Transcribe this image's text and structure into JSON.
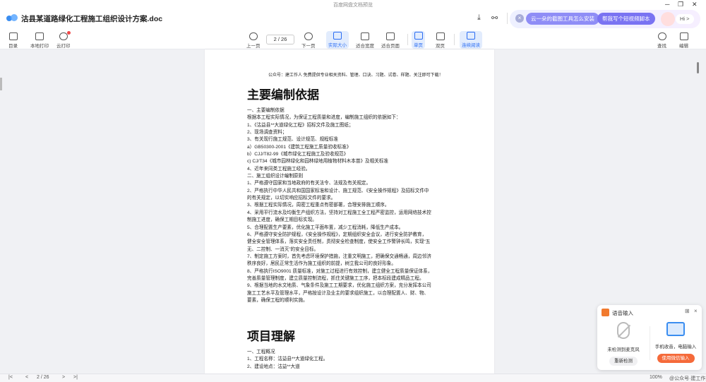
{
  "window": {
    "system_title": "百度网盘文档预览",
    "minimize": "─",
    "restore": "❐",
    "close": "✕"
  },
  "header": {
    "doc_title": "沽县某道路绿化工程施工组织设计方案.doc",
    "ai": {
      "close": "×",
      "chip1": "云一朵的截图工具怎么安装",
      "chip2": "帮我写个短视频脚本",
      "greeting": "Hi >"
    }
  },
  "toolbar": {
    "catalog": "目录",
    "local_print": "本地打印",
    "cloud_print": "云打印",
    "prev_page": "上一页",
    "page_indicator": "2  /  26",
    "next_page": "下一页",
    "actual_size": "实际大小",
    "fit_width": "适合宽度",
    "fit_page": "适合页面",
    "single_page": "单页",
    "double_page": "双页",
    "continuous": "连续阅读",
    "search": "查找",
    "edit": "编辑"
  },
  "document": {
    "header_note": "公众号：建工作人  免费提供专业相关资料、管理、口诀、习题、试卷、样题、关注即可下载！",
    "section1_title": "主要编制依据",
    "section1_lines": [
      "一、主要编制依据",
      "根据本工程实际情况，为保证工程质量和进度，编制施工组织的依据如下：",
      "1、《沽益县**大道绿化工程》招标文件及施工图纸；",
      "2、现场调查资料；",
      "3、有关现行施工规范、设计规范、规程标准",
      "a）GB50300-2001《建筑工程施工质量验收标准》",
      "b）CJJ/T82-99《城市绿化工程施工及验收规范》",
      "c) CJ/T34《城市园林绿化和园林绿地用植物材料木本苗》及相关标准",
      "4、近年来同类工程施工经验。",
      "二、施工组织设计编制原则",
      "1、严格遵守国家和当地政府的有关法令、法规及有关规定。",
      "2、严格执行中华人民共和国国家标准和设计、施工规范、《安全操作规程》及招标文件中",
      "的有关规定，以切实响应招标文件的要求。",
      "3、根据工程实际情况，周密工程重点有密部署，合理安排施工顺序。",
      "4、采用平行流水及均衡生产组织方法，坚持对工程施工全工程严密监控，运用网络技术控",
      "制施工进度，确保工期目标实现。",
      "5、合理配置生产要素，优化施工平面布置，减少工程消耗，降低生产成本。",
      "6、严格遵守安全防护规程，《安全操作规程》，定期组织安全会议，进行安全防护教育，",
      "健全安全管理体系，落实安全责任制，贯彻安全检查制度，使安全工作警钟长鸣，实现“五",
      "无、二控制、一消灭”的安全目标。",
      "7、制定施工方案时，首先考虑环境保护措施，注重文明施工，把确保交通畅通，周边邻济",
      "秩序良好，居民正常生活作为施工组织的前提，树立我公司的良好形象。",
      "8、严格执行ISO9001 质量标准，对施工过程进行有效控制，建立健全工程质量保证体系，",
      "完善质量管理制度，建立质量控制流程，抓住关键施工工序，把本标段建成精品工程。",
      "9、根据当地的水文地质、气象条件及施工工期要求，优化施工组织方案，充分发挥本公司",
      "施工工艺水平及管理水平，严格按设计及业主的要求组织施工，以合理配置人、财、物、",
      "要素，确保工程的顺利实施。"
    ],
    "section2_title": "项目理解",
    "section2_lines": [
      "一、工程概况",
      "1、工程名称：沽益县**大道绿化工程。",
      "2、建设地点：沽益**大道"
    ]
  },
  "bottom": {
    "first": "|<",
    "prev": "<",
    "page": "2  /  26",
    "next": ">",
    "last": ">|",
    "zoom": "100%",
    "watermark": "@公众号·建工作人"
  },
  "voice_widget": {
    "title": "语音输入",
    "grid": "⊞",
    "close": "×",
    "mic_status": "未检测到麦克风",
    "recheck": "重新检测",
    "phone_label": "手机收音，电脑输入",
    "use_phone": "使用微信输入"
  },
  "colors": {
    "accent": "#2b6df3",
    "chip1": "#8f8df6",
    "chip2": "#7a73f2",
    "orange": "#f56a3a"
  }
}
